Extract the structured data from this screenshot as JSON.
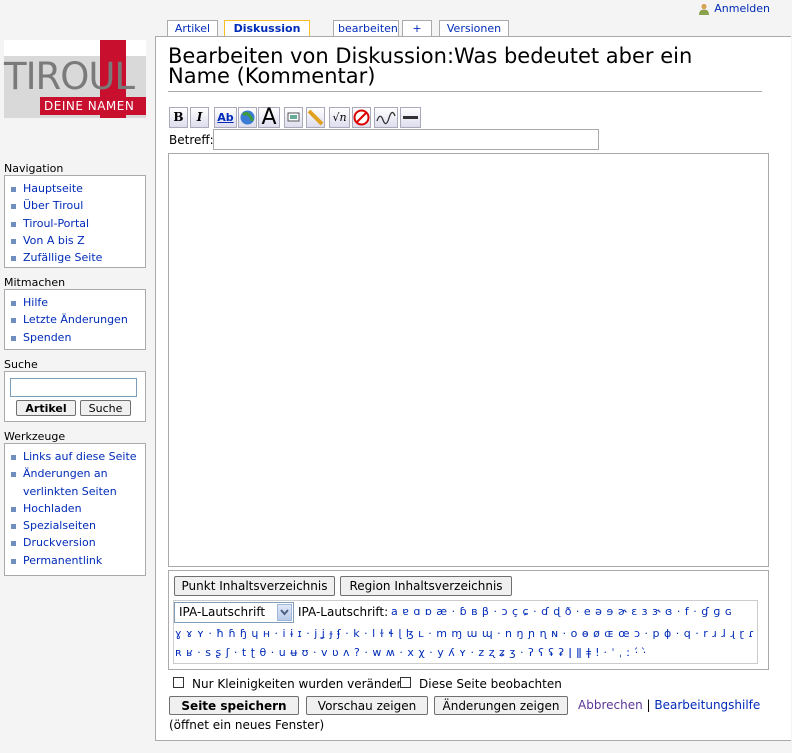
{
  "personal": {
    "login": "Anmelden"
  },
  "tabs": [
    {
      "label": "Artikel"
    },
    {
      "label": "Diskussion"
    },
    {
      "label": "bearbeiten"
    },
    {
      "label": "+"
    },
    {
      "label": "Versionen"
    }
  ],
  "logo": {
    "name": "TIROUL",
    "tagline": "DEINE NAMEN"
  },
  "navigation": {
    "heading": "Navigation",
    "items": [
      "Hauptseite",
      "Über Tiroul",
      "Tiroul-Portal",
      "Von A bis Z",
      "Zufällige Seite"
    ]
  },
  "mitmachen": {
    "heading": "Mitmachen",
    "items": [
      "Hilfe",
      "Letzte Änderungen",
      "Spenden"
    ]
  },
  "search": {
    "heading": "Suche",
    "value": "",
    "go_label": "Artikel",
    "search_label": "Suche"
  },
  "werkzeuge": {
    "heading": "Werkzeuge",
    "items": [
      "Links auf diese Seite",
      "Änderungen an",
      "verlinkten Seiten",
      "Hochladen",
      "Spezialseiten",
      "Druckversion",
      "Permanentlink"
    ]
  },
  "page": {
    "title_line1": "Bearbeiten von Diskussion:Was bedeutet aber ein",
    "title_line2": "Name (Kommentar)"
  },
  "toolbar": {
    "bold": "B",
    "italic": "I",
    "link": "Ab",
    "big": "A",
    "icons": [
      "bold-icon",
      "italic-icon",
      "internal-link-icon",
      "external-link-icon",
      "headline-icon",
      "image-icon",
      "media-icon",
      "math-icon",
      "nowiki-icon",
      "signature-icon",
      "horizontal-line-icon"
    ]
  },
  "summary": {
    "label": "Betreff:",
    "value": ""
  },
  "textarea": {
    "value": ""
  },
  "special": {
    "btn_punkt": "Punkt Inhaltsverzeichnis",
    "btn_region": "Region Inhaltsverzeichnis",
    "select_value": "IPA-Lautschrift",
    "ipa_label": "IPA-Lautschrift:",
    "ipa_line1": "a ɐ ɑ ɒ æ · ɓ ʙ β · ɔ ç ɕ · ɗ ɖ ð · e ə ɘ ɚ ɛ ɜ ɝ ɞ · f · ɠ ɡ ɢ",
    "ipa_line2": "ɣ ɤ ʏ · ħ ɦ ɧ ɥ ʜ · i ɨ ɪ · j ʝ ɟ ʄ · k · l ɫ ɬ ɭ ɮ ʟ · m ɱ ɯ ɰ · n ŋ ɲ ɳ ɴ · o ɵ ø ɶ œ ɔ · p ɸ · q · r ɹ ɺ ɻ ɽ ɾ",
    "ipa_line3": "ʀ ʁ · s ʂ ʃ · t ʈ θ · u ʉ ʊ · v ʋ ʌ ? · w ʍ · x χ · y ʎ ʏ · z ʐ ʑ ʒ · ʔ ʕ ʢ ʡ ǀ ǁ ǂ ǃ · ˈ ˌ ː ·́ ·̀"
  },
  "options": {
    "minor": "Nur Kleinigkeiten wurden verändert",
    "watch": "Diese Seite beobachten"
  },
  "actions": {
    "save": "Seite speichern",
    "preview": "Vorschau zeigen",
    "diff": "Änderungen zeigen",
    "cancel": "Abbrechen",
    "separator": "|",
    "help": "Bearbeitungshilfe",
    "help_note": "(öffnet ein neues Fenster)"
  }
}
